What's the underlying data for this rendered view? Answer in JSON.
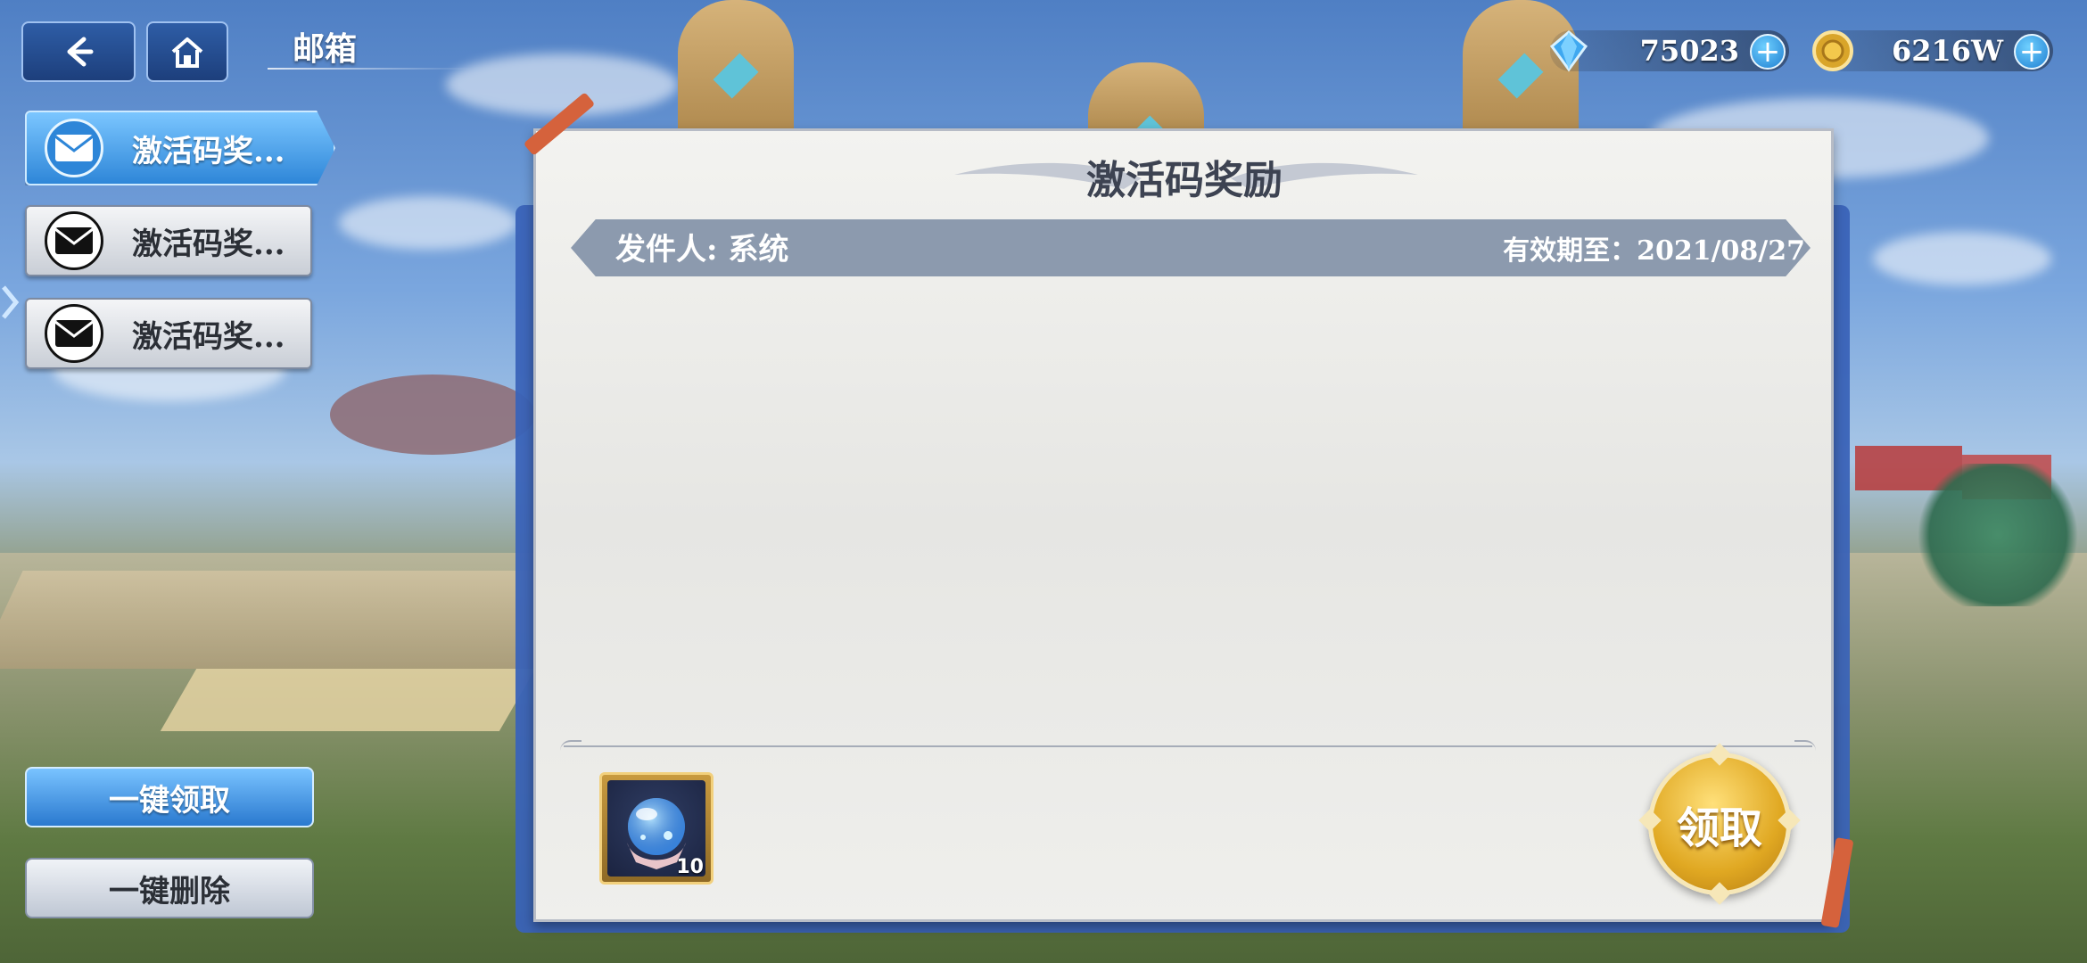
{
  "header": {
    "title": "邮箱"
  },
  "currencies": [
    {
      "icon": "diamond-icon",
      "amount": "75023"
    },
    {
      "icon": "gold-coin-icon",
      "amount": "6216W"
    }
  ],
  "mail_list": [
    {
      "label": "激活码奖...",
      "active": true
    },
    {
      "label": "激活码奖...",
      "active": false
    },
    {
      "label": "激活码奖...",
      "active": false
    }
  ],
  "bulk_actions": {
    "claim_all": "一键领取",
    "delete_all": "一键删除"
  },
  "mail": {
    "title": "激活码奖励",
    "sender": "发件人: 系统",
    "expiry": "有效期至：2021/08/27",
    "body": "",
    "rewards": [
      {
        "icon": "crystal-orb-icon",
        "count": "10"
      }
    ],
    "collect_label": "领取"
  },
  "colors": {
    "accent_blue": "#2e86d8",
    "gold": "#e0a822",
    "panel": "#efefec",
    "sender_bar": "#8c9aae"
  }
}
